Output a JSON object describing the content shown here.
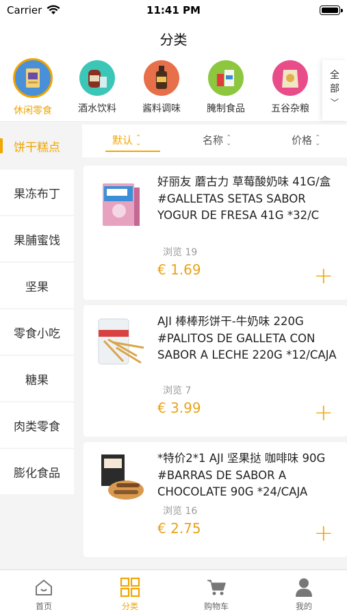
{
  "status": {
    "carrier": "Carrier",
    "time": "11:41 PM"
  },
  "nav": {
    "title": "分类"
  },
  "categories": [
    {
      "label": "休闲零食",
      "color": "#4a90d9"
    },
    {
      "label": "酒水饮料",
      "color": "#3cc6b8"
    },
    {
      "label": "酱料调味",
      "color": "#e76f4a"
    },
    {
      "label": "腌制食品",
      "color": "#8dc63f"
    },
    {
      "label": "五谷杂粮",
      "color": "#e84d8a"
    }
  ],
  "all_button": {
    "line1": "全",
    "line2": "部",
    "arrow": "﹀"
  },
  "subcategories": [
    "饼干糕点",
    "果冻布丁",
    "果脯蜜饯",
    "坚果",
    "零食小吃",
    "糖果",
    "肉类零食",
    "膨化食品"
  ],
  "sort": [
    {
      "label": "默认",
      "arrow": "⌃⌄"
    },
    {
      "label": "名称",
      "arrow": "⌃⌄"
    },
    {
      "label": "价格",
      "arrow": "⌃⌄"
    }
  ],
  "products": [
    {
      "name": "好丽友 蘑古力 草莓酸奶味 41G/盒 #GALLETAS SETAS SABOR YOGUR DE FRESA 41G *32/C",
      "views": "浏览 19",
      "price": "€ 1.69",
      "add": "+"
    },
    {
      "name": "AJI 棒棒形饼干-牛奶味 220G #PALITOS DE GALLETA CON SABOR A LECHE 220G *12/CAJA",
      "views": "浏览 7",
      "price": "€ 3.99",
      "add": "+"
    },
    {
      "name": "*特价2*1 AJI 坚果挞 咖啡味 90G #BARRAS DE SABOR A CHOCOLATE 90G *24/CAJA",
      "views": "浏览 16",
      "price": "€ 2.75",
      "add": "+"
    }
  ],
  "tabs": [
    {
      "label": "首页",
      "icon": "home-icon"
    },
    {
      "label": "分类",
      "icon": "grid-icon"
    },
    {
      "label": "购物车",
      "icon": "cart-icon"
    },
    {
      "label": "我的",
      "icon": "user-icon"
    }
  ],
  "colors": {
    "accent": "#f0a500",
    "price": "#e8a31a"
  }
}
